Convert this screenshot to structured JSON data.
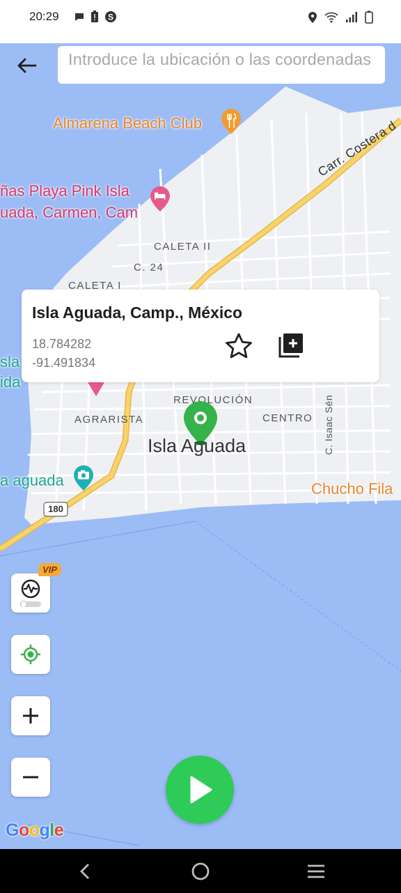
{
  "status_bar": {
    "time": "20:29",
    "left_icons": [
      "chat-bubble-icon",
      "battery-alert-icon",
      "s-app-icon"
    ],
    "right_icons": [
      "location-icon",
      "wifi-icon",
      "signal-icon",
      "battery-icon"
    ]
  },
  "search": {
    "placeholder": "Introduce la ubicación o las coordenadas",
    "value": ""
  },
  "map": {
    "pois": {
      "almarena": "Almarena Beach Club",
      "cabanas_line1": "ñas Playa Pink Isla",
      "cabanas_line2": "uada, Carmen, Cam",
      "isla_aguada_photo": "a aguada",
      "chucho": "Chucho Fila",
      "sla_fragment_1": "sla",
      "sla_fragment_2": "ida"
    },
    "streets": {
      "caleta_ii": "CALETA II",
      "c24": "C. 24",
      "caleta_i": "CALETA I",
      "revolucion": "REVOLUCIÓN",
      "agrarista": "AGRARISTA",
      "centro": "CENTRO",
      "isaac": "C. Isaac Sén",
      "carr_costera": "Carr. Costera d",
      "route": "180"
    },
    "town": "Isla Aguada",
    "attribution": "Google",
    "colors": {
      "water": "#9cbcf6",
      "land": "#eef0f3",
      "highway": "#f5c64e",
      "road": "#ffffff",
      "pin": "#35b24a"
    }
  },
  "location_card": {
    "title": "Isla Aguada, Camp., México",
    "latitude": "18.784282",
    "longitude": "-91.491834",
    "favorite_icon": "star-outline-icon",
    "copy_icon": "copy-add-icon"
  },
  "controls": {
    "vip_badge": "VIP",
    "buttons": [
      "route-mode-icon",
      "my-location-icon",
      "zoom-in-icon",
      "zoom-out-icon"
    ],
    "play_icon": "play-icon"
  },
  "nav_bar": {
    "buttons": [
      "back-nav-icon",
      "home-nav-icon",
      "recents-nav-icon"
    ]
  }
}
